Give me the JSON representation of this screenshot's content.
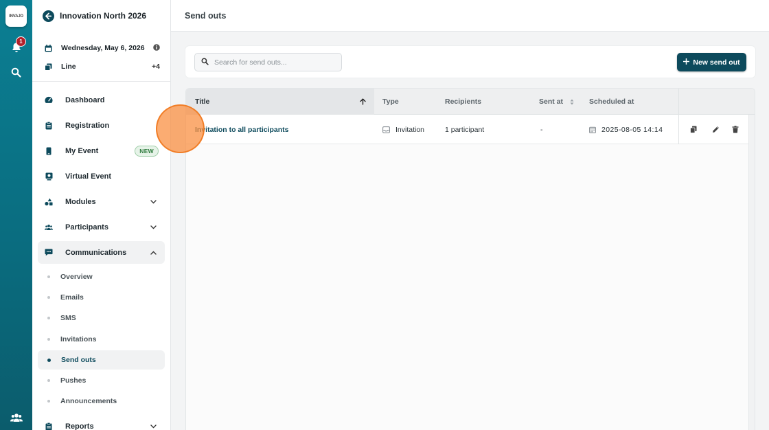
{
  "rail": {
    "logo_text": "INVAJO",
    "notification_count": "1"
  },
  "sidebar": {
    "event_title": "Innovation North 2026",
    "date": "Wednesday, May 6, 2026",
    "line_label": "Line",
    "line_extra": "+4",
    "nav": [
      {
        "label": "Dashboard"
      },
      {
        "label": "Registration"
      },
      {
        "label": "My Event",
        "badge": "NEW"
      },
      {
        "label": "Virtual Event"
      },
      {
        "label": "Modules"
      },
      {
        "label": "Participants"
      },
      {
        "label": "Communications"
      }
    ],
    "sub": [
      {
        "label": "Overview"
      },
      {
        "label": "Emails"
      },
      {
        "label": "SMS"
      },
      {
        "label": "Invitations"
      },
      {
        "label": "Send outs"
      },
      {
        "label": "Pushes"
      },
      {
        "label": "Announcements"
      }
    ],
    "reports_label": "Reports"
  },
  "page": {
    "title": "Send outs"
  },
  "toolbar": {
    "search_placeholder": "Search for send outs...",
    "new_label": "New send out"
  },
  "table": {
    "columns": [
      "Title",
      "Type",
      "Recipients",
      "Sent at",
      "Scheduled at"
    ],
    "rows": [
      {
        "title": "Invitation to all participants",
        "type": "Invitation",
        "recipients": "1 participant",
        "sent_at": "-",
        "scheduled_at": "2025-08-05 14:14"
      }
    ]
  },
  "colors": {
    "brand": "#0d4a5c",
    "rail": "#0a6d80",
    "badge": "#b3202a",
    "pointer": "#f98c3c"
  }
}
